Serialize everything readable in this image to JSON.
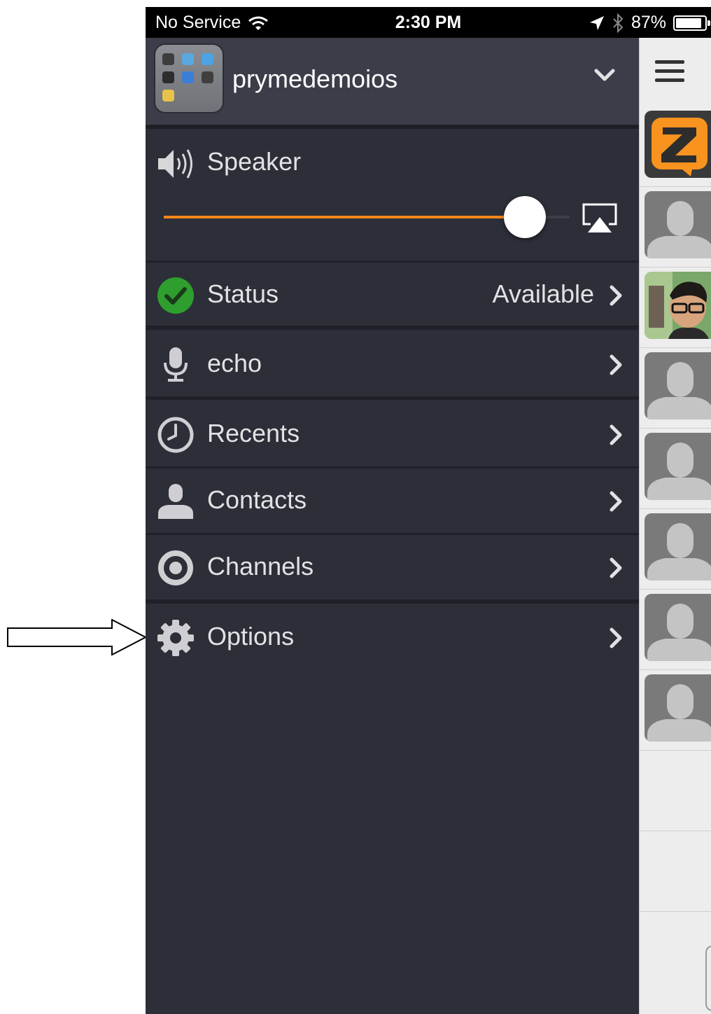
{
  "status_bar": {
    "carrier": "No Service",
    "time": "2:30 PM",
    "battery": "87%"
  },
  "account": {
    "name": "prymedemoios",
    "folder_colors": [
      "#3d3d3d",
      "#5aa8e0",
      "#4da3e3",
      "#2d2d2d",
      "#3b7ed8",
      "#3f3f3f",
      "#e8c24b"
    ]
  },
  "speaker": {
    "label": "Speaker",
    "volume_fraction": 0.89
  },
  "menu": {
    "status": {
      "label": "Status",
      "value": "Available"
    },
    "echo": {
      "label": "echo"
    },
    "recents": {
      "label": "Recents"
    },
    "contacts": {
      "label": "Contacts"
    },
    "channels": {
      "label": "Channels"
    },
    "options": {
      "label": "Options"
    }
  },
  "colors": {
    "accent": "#f7861a",
    "drawer_bg": "#2c2e38",
    "available_green": "#2e9e2e",
    "zello_orange": "#f7931e"
  },
  "rail_items": [
    {
      "type": "zello-logo-icon"
    },
    {
      "type": "default-avatar-icon"
    },
    {
      "type": "user-photo"
    },
    {
      "type": "default-avatar-icon"
    },
    {
      "type": "default-avatar-icon"
    },
    {
      "type": "default-avatar-icon"
    },
    {
      "type": "default-avatar-icon"
    },
    {
      "type": "default-avatar-icon"
    },
    {
      "type": "empty"
    },
    {
      "type": "empty"
    }
  ]
}
